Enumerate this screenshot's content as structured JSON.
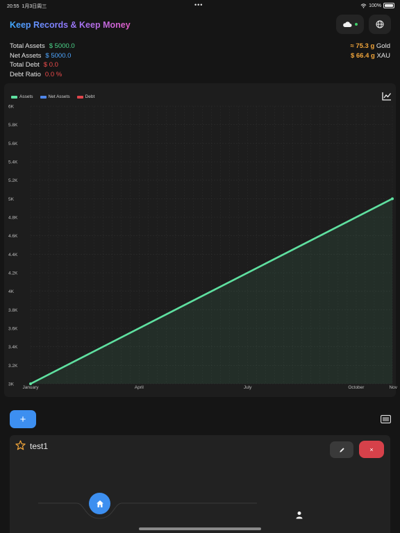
{
  "status_bar": {
    "time": "20:55",
    "date": "1月3日周三",
    "dots": "•••",
    "wifi_icon": "wifi-icon",
    "battery": "100%"
  },
  "header": {
    "title": "Keep Records & Keep Money",
    "cloud_icon": "cloud-icon",
    "globe_icon": "globe-icon"
  },
  "summary": {
    "total_assets_label": "Total Assets",
    "total_assets_value": "$ 5000.0",
    "net_assets_label": "Net Assets",
    "net_assets_value": "$ 5000.0",
    "total_debt_label": "Total Debt",
    "total_debt_value": "$ 0.0",
    "debt_ratio_label": "Debt Ratio",
    "debt_ratio_value": "0.0 %"
  },
  "gold": {
    "gold_amount": "≈ 75.3 g",
    "gold_unit": "Gold",
    "xau_amount": "$ 66.4 g",
    "xau_unit": "XAU"
  },
  "colors": {
    "assets": "#5fe0a0",
    "net_assets": "#4f86e8",
    "debt": "#e0454b",
    "accent": "#3d8ff0"
  },
  "chart_data": {
    "type": "line",
    "legend": [
      "Assets",
      "Net Assets",
      "Debt"
    ],
    "legend_position": "top-left",
    "grid": true,
    "y_ticks": [
      "3K",
      "3.2K",
      "3.4K",
      "3.6K",
      "3.8K",
      "4K",
      "4.2K",
      "4.4K",
      "4.6K",
      "4.8K",
      "5K",
      "5.2K",
      "5.4K",
      "5.6K",
      "5.8K",
      "6K"
    ],
    "ylim": [
      3000,
      6000
    ],
    "x_ticks": [
      "January",
      "April",
      "July",
      "October",
      "Nov"
    ],
    "series": [
      {
        "name": "Assets",
        "points": [
          [
            "January",
            3000
          ],
          [
            "Nov",
            5000
          ]
        ]
      }
    ]
  },
  "toolbar": {
    "add_label": "+",
    "list_icon": "list-icon",
    "chart_icon": "chart-icon"
  },
  "record": {
    "name": "test1",
    "star_icon": "star-icon",
    "edit_icon": "pencil-icon",
    "delete_label": "×"
  },
  "tabbar": {
    "home_icon": "home-icon",
    "profile_icon": "person-icon"
  }
}
